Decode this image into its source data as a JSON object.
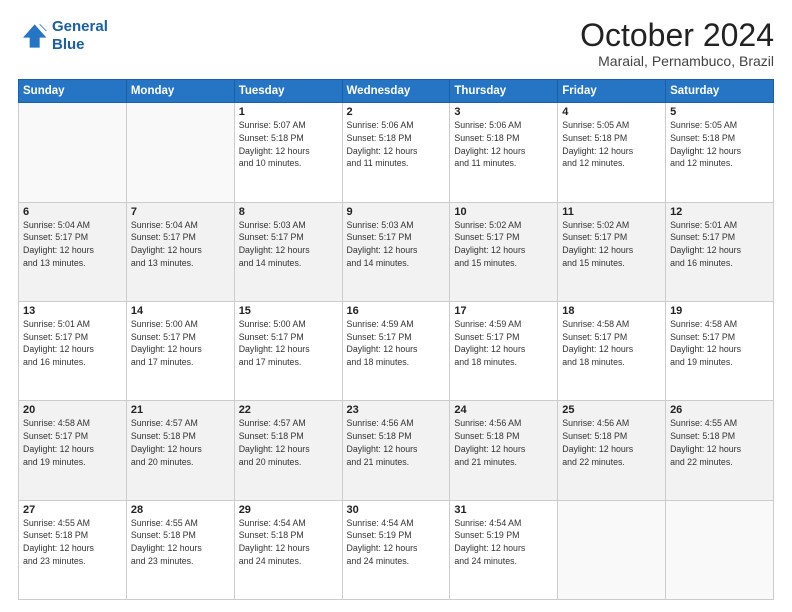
{
  "header": {
    "logo_line1": "General",
    "logo_line2": "Blue",
    "month": "October 2024",
    "location": "Maraial, Pernambuco, Brazil"
  },
  "days_of_week": [
    "Sunday",
    "Monday",
    "Tuesday",
    "Wednesday",
    "Thursday",
    "Friday",
    "Saturday"
  ],
  "weeks": [
    [
      {
        "day": "",
        "info": ""
      },
      {
        "day": "",
        "info": ""
      },
      {
        "day": "1",
        "info": "Sunrise: 5:07 AM\nSunset: 5:18 PM\nDaylight: 12 hours\nand 10 minutes."
      },
      {
        "day": "2",
        "info": "Sunrise: 5:06 AM\nSunset: 5:18 PM\nDaylight: 12 hours\nand 11 minutes."
      },
      {
        "day": "3",
        "info": "Sunrise: 5:06 AM\nSunset: 5:18 PM\nDaylight: 12 hours\nand 11 minutes."
      },
      {
        "day": "4",
        "info": "Sunrise: 5:05 AM\nSunset: 5:18 PM\nDaylight: 12 hours\nand 12 minutes."
      },
      {
        "day": "5",
        "info": "Sunrise: 5:05 AM\nSunset: 5:18 PM\nDaylight: 12 hours\nand 12 minutes."
      }
    ],
    [
      {
        "day": "6",
        "info": "Sunrise: 5:04 AM\nSunset: 5:17 PM\nDaylight: 12 hours\nand 13 minutes."
      },
      {
        "day": "7",
        "info": "Sunrise: 5:04 AM\nSunset: 5:17 PM\nDaylight: 12 hours\nand 13 minutes."
      },
      {
        "day": "8",
        "info": "Sunrise: 5:03 AM\nSunset: 5:17 PM\nDaylight: 12 hours\nand 14 minutes."
      },
      {
        "day": "9",
        "info": "Sunrise: 5:03 AM\nSunset: 5:17 PM\nDaylight: 12 hours\nand 14 minutes."
      },
      {
        "day": "10",
        "info": "Sunrise: 5:02 AM\nSunset: 5:17 PM\nDaylight: 12 hours\nand 15 minutes."
      },
      {
        "day": "11",
        "info": "Sunrise: 5:02 AM\nSunset: 5:17 PM\nDaylight: 12 hours\nand 15 minutes."
      },
      {
        "day": "12",
        "info": "Sunrise: 5:01 AM\nSunset: 5:17 PM\nDaylight: 12 hours\nand 16 minutes."
      }
    ],
    [
      {
        "day": "13",
        "info": "Sunrise: 5:01 AM\nSunset: 5:17 PM\nDaylight: 12 hours\nand 16 minutes."
      },
      {
        "day": "14",
        "info": "Sunrise: 5:00 AM\nSunset: 5:17 PM\nDaylight: 12 hours\nand 17 minutes."
      },
      {
        "day": "15",
        "info": "Sunrise: 5:00 AM\nSunset: 5:17 PM\nDaylight: 12 hours\nand 17 minutes."
      },
      {
        "day": "16",
        "info": "Sunrise: 4:59 AM\nSunset: 5:17 PM\nDaylight: 12 hours\nand 18 minutes."
      },
      {
        "day": "17",
        "info": "Sunrise: 4:59 AM\nSunset: 5:17 PM\nDaylight: 12 hours\nand 18 minutes."
      },
      {
        "day": "18",
        "info": "Sunrise: 4:58 AM\nSunset: 5:17 PM\nDaylight: 12 hours\nand 18 minutes."
      },
      {
        "day": "19",
        "info": "Sunrise: 4:58 AM\nSunset: 5:17 PM\nDaylight: 12 hours\nand 19 minutes."
      }
    ],
    [
      {
        "day": "20",
        "info": "Sunrise: 4:58 AM\nSunset: 5:17 PM\nDaylight: 12 hours\nand 19 minutes."
      },
      {
        "day": "21",
        "info": "Sunrise: 4:57 AM\nSunset: 5:18 PM\nDaylight: 12 hours\nand 20 minutes."
      },
      {
        "day": "22",
        "info": "Sunrise: 4:57 AM\nSunset: 5:18 PM\nDaylight: 12 hours\nand 20 minutes."
      },
      {
        "day": "23",
        "info": "Sunrise: 4:56 AM\nSunset: 5:18 PM\nDaylight: 12 hours\nand 21 minutes."
      },
      {
        "day": "24",
        "info": "Sunrise: 4:56 AM\nSunset: 5:18 PM\nDaylight: 12 hours\nand 21 minutes."
      },
      {
        "day": "25",
        "info": "Sunrise: 4:56 AM\nSunset: 5:18 PM\nDaylight: 12 hours\nand 22 minutes."
      },
      {
        "day": "26",
        "info": "Sunrise: 4:55 AM\nSunset: 5:18 PM\nDaylight: 12 hours\nand 22 minutes."
      }
    ],
    [
      {
        "day": "27",
        "info": "Sunrise: 4:55 AM\nSunset: 5:18 PM\nDaylight: 12 hours\nand 23 minutes."
      },
      {
        "day": "28",
        "info": "Sunrise: 4:55 AM\nSunset: 5:18 PM\nDaylight: 12 hours\nand 23 minutes."
      },
      {
        "day": "29",
        "info": "Sunrise: 4:54 AM\nSunset: 5:18 PM\nDaylight: 12 hours\nand 24 minutes."
      },
      {
        "day": "30",
        "info": "Sunrise: 4:54 AM\nSunset: 5:19 PM\nDaylight: 12 hours\nand 24 minutes."
      },
      {
        "day": "31",
        "info": "Sunrise: 4:54 AM\nSunset: 5:19 PM\nDaylight: 12 hours\nand 24 minutes."
      },
      {
        "day": "",
        "info": ""
      },
      {
        "day": "",
        "info": ""
      }
    ]
  ]
}
